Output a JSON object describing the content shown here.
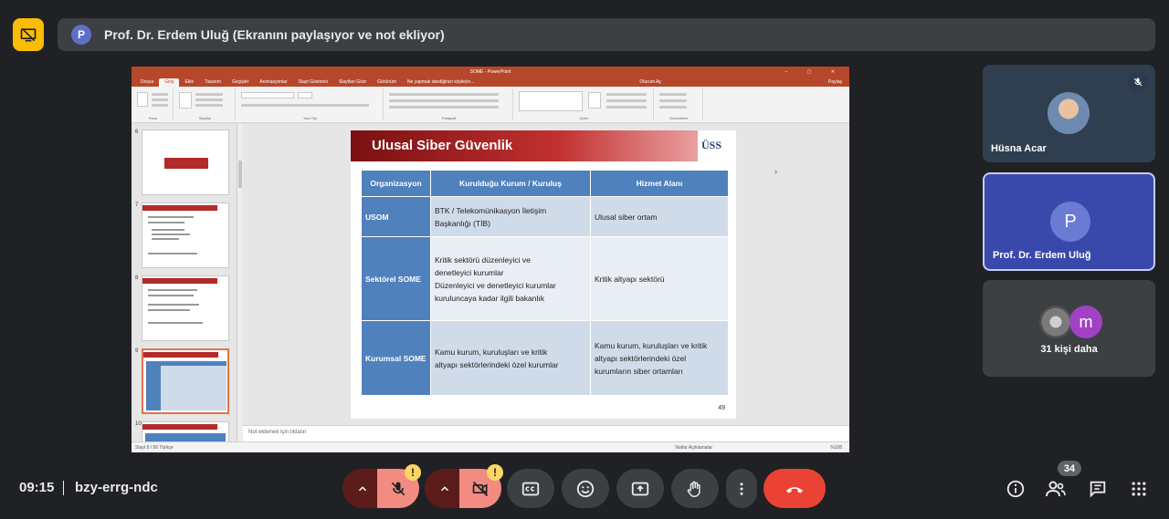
{
  "banner": {
    "avatar_letter": "P",
    "text": "Prof. Dr. Erdem Uluğ (Ekranını paylaşıyor ve not ekliyor)"
  },
  "ppt": {
    "window_title": "SOME - PowerPoint",
    "tabs": [
      "Dosya",
      "Giriş",
      "Ekle",
      "Tasarım",
      "Geçişler",
      "Animasyonlar",
      "Slayt Gösterisi",
      "Slaytları Gözr",
      "Görünüm"
    ],
    "active_tab": "Giriş",
    "tell_me": "Ne yapmak istediğinizi söyleyin...",
    "sign_in": "Oturum Aç",
    "share": "Paylaş",
    "groups": [
      "Pano",
      "Slaytlar",
      "Yazı Tipi",
      "Paragraf",
      "Çizim",
      "Düzenleme"
    ],
    "thumb_numbers": [
      "6",
      "7",
      "8",
      "9",
      "10"
    ],
    "notes_placeholder": "Not eklemek için tıklatın",
    "status_left": "Slayt 9 / 56    Türkçe",
    "status_notes": "Notlar    Açıklamalar",
    "zoom": "%108"
  },
  "slide": {
    "title": "Ulusal Siber Güvenlik",
    "logo": "ÜSS",
    "headers": [
      "Organizasyon",
      "Kurulduğu Kurum / Kuruluş",
      "Hizmet Alanı"
    ],
    "rows": [
      {
        "org": "USOM",
        "kurum": [
          "BTK / Telekomünikasyon İletişim",
          "Başkanlığı (TİB)"
        ],
        "hizmet": [
          "Ulusal siber ortam"
        ]
      },
      {
        "org": "Sektörel SOME",
        "kurum": [
          "Kritik sektörü düzenleyici ve",
          "denetleyici kurumlar",
          "Düzenleyici ve denetleyici kurumlar",
          "kuruluncaya kadar ilgili bakanlık"
        ],
        "hizmet": [
          "Kritik altyapı sektörü"
        ]
      },
      {
        "org": "Kurumsal SOME",
        "kurum": [
          "Kamu kurum, kuruluşları ve kritik",
          "altyapı sektörlerindeki özel kurumlar"
        ],
        "hizmet": [
          "Kamu kurum, kuruluşları ve kritik",
          "altyapı sektörlerindeki özel",
          "kurumların siber ortamları"
        ]
      }
    ],
    "page_number": "49"
  },
  "participants": [
    {
      "name": "Hüsna Acar",
      "muted": true
    },
    {
      "name": "Prof. Dr. Erdem Uluğ",
      "avatar_letter": "P"
    },
    {
      "more_text": "31 kişi daha",
      "avatar_letter": "m"
    }
  ],
  "bottom": {
    "time": "09:15",
    "meeting_code": "bzy-errg-ndc",
    "warning_glyph": "!",
    "people_count": "34"
  },
  "colors": {
    "accent": "#fbbc04",
    "hangup": "#ea4335",
    "muted_red": "#f28b82",
    "ppt_brand": "#b7472a",
    "table_header": "#4f81bd"
  }
}
